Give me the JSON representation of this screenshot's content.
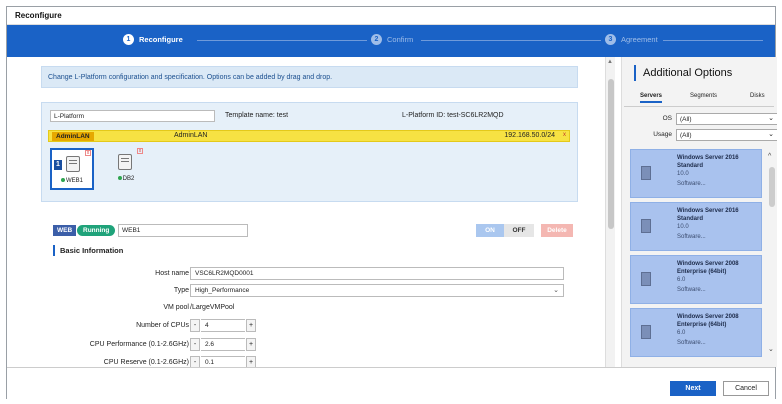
{
  "window": {
    "title": "Reconfigure"
  },
  "steps": [
    {
      "num": "1",
      "label": "Reconfigure"
    },
    {
      "num": "2",
      "label": "Confirm"
    },
    {
      "num": "3",
      "label": "Agreement"
    }
  ],
  "info": {
    "text": "Change L-Platform configuration and specification. Options can be added by drag and drop."
  },
  "platform": {
    "name_value": "L-Platform",
    "template": "Template name: test",
    "id": "L-Platform ID: test-SC6LR2MQD",
    "lan": {
      "tag": "AdminLAN",
      "name": "AdminLAN",
      "subnet": "192.168.50.0/24",
      "remove": "x"
    },
    "servers": [
      {
        "label": "WEB1",
        "badge": "1",
        "remove": "x"
      },
      {
        "label": "DB2",
        "remove": "x"
      }
    ]
  },
  "server_detail": {
    "type_badge": "WEB",
    "status_badge": "Running",
    "name_value": "WEB1",
    "on_label": "ON",
    "off_label": "OFF",
    "delete_label": "Delete"
  },
  "basic_info": {
    "title": "Basic Information",
    "host_name": {
      "label": "Host name",
      "value": "VSC6LR2MQD0001"
    },
    "type": {
      "label": "Type",
      "value": "High_Performance"
    },
    "vm_pool": {
      "label": "VM pool",
      "value": "/LargeVMPool"
    },
    "cpus": {
      "label": "Number of CPUs",
      "value": "4"
    },
    "cpu_perf": {
      "label": "CPU Performance (0.1-2.6GHz)",
      "value": "2.6"
    },
    "cpu_reserve": {
      "label": "CPU Reserve (0.1-2.6GHz)",
      "value": "0.1"
    },
    "minus": "-",
    "plus": "+"
  },
  "side": {
    "title": "Additional Options",
    "tabs": [
      "Servers",
      "Segments",
      "Disks"
    ],
    "os": {
      "label": "OS",
      "value": "(All)"
    },
    "usage": {
      "label": "Usage",
      "value": "(All)"
    },
    "cards": [
      {
        "name": "Windows Server 2016 Standard",
        "version": "10.0",
        "soft": "Software..."
      },
      {
        "name": "Windows Server 2016 Standard",
        "version": "10.0",
        "soft": "Software..."
      },
      {
        "name": "Windows Server 2008 Enterprise (64bit)",
        "version": "6.0",
        "soft": "Software..."
      },
      {
        "name": "Windows Server 2008 Enterprise (64bit)",
        "version": "6.0",
        "soft": "Software..."
      }
    ]
  },
  "footer": {
    "next": "Next",
    "cancel": "Cancel"
  },
  "colors": {
    "accent": "#1a62c6",
    "lan_yellow": "#f7e243",
    "card_blue": "#a9c2ee",
    "running_green": "#1fa37a"
  }
}
